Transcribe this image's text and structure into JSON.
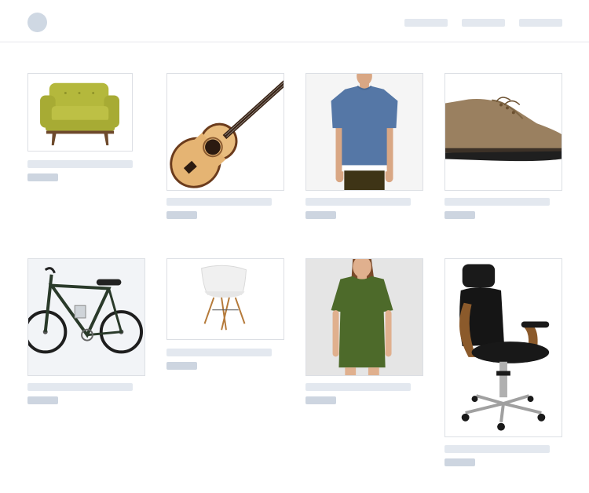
{
  "theme": {
    "placeholder_light": "#e3e8ef",
    "placeholder_dark": "#cdd5e0",
    "logo": "#cfd8e3"
  },
  "header": {
    "logo_icon": "circle-logo-icon",
    "nav_items": [
      "nav-link-placeholder",
      "nav-link-placeholder",
      "nav-link-placeholder"
    ]
  },
  "products": [
    {
      "name": "armchair",
      "icon": "armchair-icon"
    },
    {
      "name": "acoustic-guitar",
      "icon": "guitar-icon"
    },
    {
      "name": "blue-t-shirt",
      "icon": "t-shirt-icon"
    },
    {
      "name": "leather-shoe",
      "icon": "shoe-icon"
    },
    {
      "name": "bicycle",
      "icon": "bicycle-icon"
    },
    {
      "name": "white-chair",
      "icon": "chair-icon"
    },
    {
      "name": "green-dress",
      "icon": "dress-icon"
    },
    {
      "name": "office-chair",
      "icon": "office-chair-icon"
    }
  ]
}
